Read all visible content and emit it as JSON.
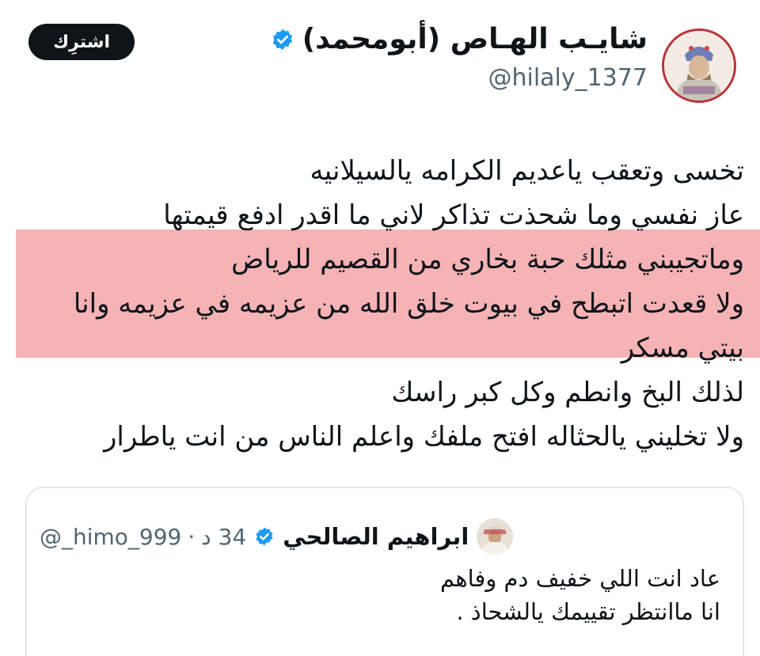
{
  "author": {
    "display_name": "شايـب الهـاص (أبومحمد)",
    "handle": "@hilaly_1377",
    "avatar_icon": "profile-avatar-icon",
    "verified_icon": "verified-badge-icon",
    "verified_color": "#1d9bf0"
  },
  "subscribe": {
    "label": "اشترِك"
  },
  "tweet": {
    "lines": [
      "تخسى وتعقب ياعديم الكرامه يالسيلانيه",
      "عاز نفسي وما شحذت تذاكر لاني ما اقدر ادفع قيمتها",
      "وماتجيبني مثلك حبة بخاري من القصيم للرياض",
      "ولا قعدت اتبطح في بيوت خلق الله من عزيمه في عزيمه وانا",
      "بيتي مسكر",
      "لذلك البخ وانطم وكل كبر راسك",
      "ولا تخليني يالحثاله افتح ملفك واعلم الناس من انت ياطرار"
    ],
    "highlight_color": "#f3a6a9"
  },
  "quote": {
    "display_name": "ابراهيم الصالحي",
    "handle": "@_himo_999",
    "separator": "·",
    "time": "34 د",
    "avatar_icon": "quote-avatar-icon",
    "verified_icon": "verified-badge-icon",
    "lines": [
      "عاد انت اللي خفيف دم وفاهم",
      "انا ماانتظر تقييمك يالشحاذ ."
    ]
  }
}
